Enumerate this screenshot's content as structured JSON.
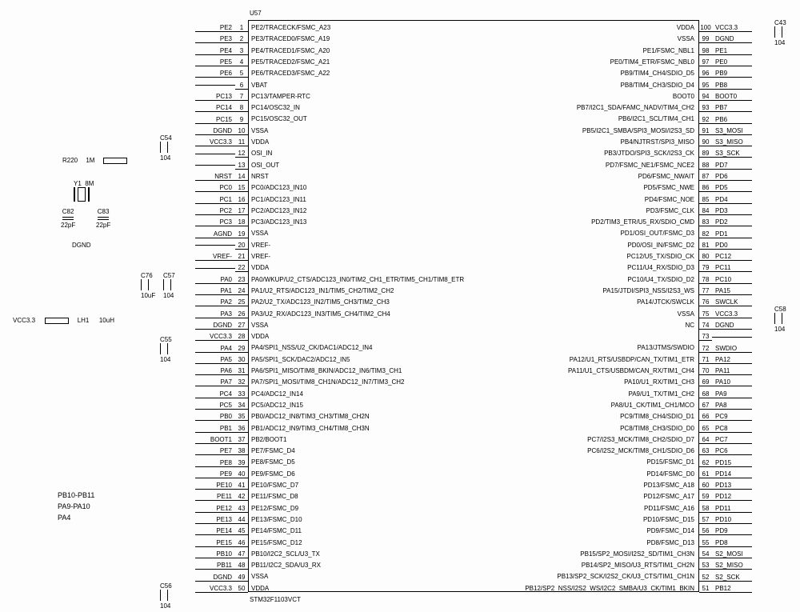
{
  "chip": {
    "ref": "U57",
    "part": "STM32F1103VCT"
  },
  "left_pins": [
    {
      "pin": "1",
      "net": "PE2",
      "func": "PE2/TRACECK/FSMC_A23"
    },
    {
      "pin": "2",
      "net": "PE3",
      "func": "PE3/TRACED0/FSMC_A19"
    },
    {
      "pin": "3",
      "net": "PE4",
      "func": "PE4/TRACED1/FSMC_A20"
    },
    {
      "pin": "4",
      "net": "PE5",
      "func": "PE5/TRACED2/FSMC_A21"
    },
    {
      "pin": "5",
      "net": "PE6",
      "func": "PE6/TRACED3/FSMC_A22"
    },
    {
      "pin": "6",
      "net": "",
      "func": "VBAT"
    },
    {
      "pin": "7",
      "net": "PC13",
      "func": "PC13/TAMPER-RTC"
    },
    {
      "pin": "8",
      "net": "PC14",
      "func": "PC14/OSC32_IN"
    },
    {
      "pin": "9",
      "net": "PC15",
      "func": "PC15/OSC32_OUT"
    },
    {
      "pin": "10",
      "net": "DGND",
      "func": "VSSA"
    },
    {
      "pin": "11",
      "net": "VCC3.3",
      "func": "VDDA"
    },
    {
      "pin": "12",
      "net": "",
      "func": "OSI_IN"
    },
    {
      "pin": "13",
      "net": "",
      "func": "OSI_OUT"
    },
    {
      "pin": "14",
      "net": "NRST",
      "func": "NRST"
    },
    {
      "pin": "15",
      "net": "PC0",
      "func": "PC0/ADC123_IN10"
    },
    {
      "pin": "16",
      "net": "PC1",
      "func": "PC1/ADC123_IN11"
    },
    {
      "pin": "17",
      "net": "PC2",
      "func": "PC2/ADC123_IN12"
    },
    {
      "pin": "18",
      "net": "PC3",
      "func": "PC3/ADC123_IN13"
    },
    {
      "pin": "19",
      "net": "AGND",
      "func": "VSSA"
    },
    {
      "pin": "20",
      "net": "",
      "func": "VREF-"
    },
    {
      "pin": "21",
      "net": "VREF-",
      "func": "VREF-"
    },
    {
      "pin": "22",
      "net": "",
      "func": "VDDA"
    },
    {
      "pin": "23",
      "net": "PA0",
      "func": "PA0/WKUP/U2_CTS/ADC123_IN0/TIM2_CH1_ETR/TIM5_CH1/TIM8_ETR"
    },
    {
      "pin": "24",
      "net": "PA1",
      "func": "PA1/U2_RTS/ADC123_IN1/TIM5_CH2/TIM2_CH2"
    },
    {
      "pin": "25",
      "net": "PA2",
      "func": "PA2/U2_TX/ADC123_IN2/TIM5_CH3/TIM2_CH3"
    },
    {
      "pin": "26",
      "net": "PA3",
      "func": "PA3/U2_RX/ADC123_IN3/TIM5_CH4/TIM2_CH4"
    },
    {
      "pin": "27",
      "net": "DGND",
      "func": "VSSA"
    },
    {
      "pin": "28",
      "net": "VCC3.3",
      "func": "VDDA"
    },
    {
      "pin": "29",
      "net": "PA4",
      "func": "PA4/SPI1_NSS/U2_CK/DAC1/ADC12_IN4"
    },
    {
      "pin": "30",
      "net": "PA5",
      "func": "PA5/SPI1_SCK/DAC2/ADC12_IN5"
    },
    {
      "pin": "31",
      "net": "PA6",
      "func": "PA6/SPI1_MISO/TIM8_BKIN/ADC12_IN6/TIM3_CH1"
    },
    {
      "pin": "32",
      "net": "PA7",
      "func": "PA7/SPI1_MOSI/TIM8_CH1N/ADC12_IN7/TIM3_CH2"
    },
    {
      "pin": "33",
      "net": "PC4",
      "func": "PC4/ADC12_IN14"
    },
    {
      "pin": "34",
      "net": "PC5",
      "func": "PC5/ADC12_IN15"
    },
    {
      "pin": "35",
      "net": "PB0",
      "func": "PB0/ADC12_IN8/TIM3_CH3/TIM8_CH2N"
    },
    {
      "pin": "36",
      "net": "PB1",
      "func": "PB1/ADC12_IN9/TIM3_CH4/TIM8_CH3N"
    },
    {
      "pin": "37",
      "net": "BOOT1",
      "func": "PB2/BOOT1"
    },
    {
      "pin": "38",
      "net": "PE7",
      "func": "PE7/FSMC_D4"
    },
    {
      "pin": "39",
      "net": "PE8",
      "func": "PE8/FSMC_D5"
    },
    {
      "pin": "40",
      "net": "PE9",
      "func": "PE9/FSMC_D6"
    },
    {
      "pin": "41",
      "net": "PE10",
      "func": "PE10/FSMC_D7"
    },
    {
      "pin": "42",
      "net": "PE11",
      "func": "PE11/FSMC_D8"
    },
    {
      "pin": "43",
      "net": "PE12",
      "func": "PE12/FSMC_D9"
    },
    {
      "pin": "44",
      "net": "PE13",
      "func": "PE13/FSMC_D10"
    },
    {
      "pin": "45",
      "net": "PE14",
      "func": "PE14/FSMC_D11"
    },
    {
      "pin": "46",
      "net": "PE15",
      "func": "PE15/FSMC_D12"
    },
    {
      "pin": "47",
      "net": "PB10",
      "func": "PB10/I2C2_SCL/U3_TX"
    },
    {
      "pin": "48",
      "net": "PB11",
      "func": "PB11/I2C2_SDA/U3_RX"
    },
    {
      "pin": "49",
      "net": "DGND",
      "func": "VSSA"
    },
    {
      "pin": "50",
      "net": "VCC3.3",
      "func": "VDDA"
    }
  ],
  "right_pins": [
    {
      "pin": "100",
      "net": "VCC3.3",
      "func": "VDDA"
    },
    {
      "pin": "99",
      "net": "DGND",
      "func": "VSSA"
    },
    {
      "pin": "98",
      "net": "PE1",
      "func": "PE1/FSMC_NBL1"
    },
    {
      "pin": "97",
      "net": "PE0",
      "func": "PE0/TIM4_ETR/FSMC_NBL0"
    },
    {
      "pin": "96",
      "net": "PB9",
      "func": "PB9/TIM4_CH4/SDIO_D5"
    },
    {
      "pin": "95",
      "net": "PB8",
      "func": "PB8/TIM4_CH3/SDIO_D4"
    },
    {
      "pin": "94",
      "net": "BOOT0",
      "func": "BOOT0"
    },
    {
      "pin": "93",
      "net": "PB7",
      "func": "PB7/I2C1_SDA/FAMC_NADV/TIM4_CH2"
    },
    {
      "pin": "92",
      "net": "PB6",
      "func": "PB6/I2C1_SCL/TIM4_CH1"
    },
    {
      "pin": "91",
      "net": "S3_MOSI",
      "func": "PB5/I2C1_SMBA/SPI3_MOSI/I2S3_SD"
    },
    {
      "pin": "90",
      "net": "S3_MISO",
      "func": "PB4/NJTRST/SPI3_MISO"
    },
    {
      "pin": "89",
      "net": "S3_SCK",
      "func": "PB3/JTDO/SPI3_SCK/I2S3_CK"
    },
    {
      "pin": "88",
      "net": "PD7",
      "func": "PD7/FSMC_NE1/FSMC_NCE2"
    },
    {
      "pin": "87",
      "net": "PD6",
      "func": "PD6/FSMC_NWAIT"
    },
    {
      "pin": "86",
      "net": "PD5",
      "func": "PD5/FSMC_NWE"
    },
    {
      "pin": "85",
      "net": "PD4",
      "func": "PD4/FSMC_NOE"
    },
    {
      "pin": "84",
      "net": "PD3",
      "func": "PD3/FSMC_CLK"
    },
    {
      "pin": "83",
      "net": "PD2",
      "func": "PD2/TIM3_ETR/U5_RX/SDIO_CMD"
    },
    {
      "pin": "82",
      "net": "PD1",
      "func": "PD1/OSI_OUT/FSMC_D3"
    },
    {
      "pin": "81",
      "net": "PD0",
      "func": "PD0/OSI_IN/FSMC_D2"
    },
    {
      "pin": "80",
      "net": "PC12",
      "func": "PC12/U5_TX/SDIO_CK"
    },
    {
      "pin": "79",
      "net": "PC11",
      "func": "PC11/U4_RX/SDIO_D3"
    },
    {
      "pin": "78",
      "net": "PC10",
      "func": "PC10/U4_TX/SDIO_D2"
    },
    {
      "pin": "77",
      "net": "PA15",
      "func": "PA15/JTDI/SPI3_NSS/I2S3_WS"
    },
    {
      "pin": "76",
      "net": "SWCLK",
      "func": "PA14/JTCK/SWCLK"
    },
    {
      "pin": "75",
      "net": "VCC3.3",
      "func": "VSSA"
    },
    {
      "pin": "74",
      "net": "DGND",
      "func": "NC"
    },
    {
      "pin": "73",
      "net": "",
      "func": ""
    },
    {
      "pin": "72",
      "net": "SWDIO",
      "func": "PA13/JTMS/SWDIO"
    },
    {
      "pin": "71",
      "net": "PA12",
      "func": "PA12/U1_RTS/USBDP/CAN_TX/TIM1_ETR"
    },
    {
      "pin": "70",
      "net": "PA11",
      "func": "PA11/U1_CTS/USBDM/CAN_RX/TIM1_CH4"
    },
    {
      "pin": "69",
      "net": "PA10",
      "func": "PA10/U1_RX/TIM1_CH3"
    },
    {
      "pin": "68",
      "net": "PA9",
      "func": "PA9/U1_TX/TIM1_CH2"
    },
    {
      "pin": "67",
      "net": "PA8",
      "func": "PA8/U1_CK/TIM1_CH1/MCO"
    },
    {
      "pin": "66",
      "net": "PC9",
      "func": "PC9/TIM8_CH4/SDIO_D1"
    },
    {
      "pin": "65",
      "net": "PC8",
      "func": "PC8/TIM8_CH3/SDIO_D0"
    },
    {
      "pin": "64",
      "net": "PC7",
      "func": "PC7/I2S3_MCK/TIM8_CH2/SDIO_D7"
    },
    {
      "pin": "63",
      "net": "PC6",
      "func": "PC6/I2S2_MCK/TIM8_CH1/SDIO_D6"
    },
    {
      "pin": "62",
      "net": "PD15",
      "func": "PD15/FSMC_D1"
    },
    {
      "pin": "61",
      "net": "PD14",
      "func": "PD14/FSMC_D0"
    },
    {
      "pin": "60",
      "net": "PD13",
      "func": "PD13/FSMC_A18"
    },
    {
      "pin": "59",
      "net": "PD12",
      "func": "PD12/FSMC_A17"
    },
    {
      "pin": "58",
      "net": "PD11",
      "func": "PD11/FSMC_A16"
    },
    {
      "pin": "57",
      "net": "PD10",
      "func": "PD10/FSMC_D15"
    },
    {
      "pin": "56",
      "net": "PD9",
      "func": "PD9/FSMC_D14"
    },
    {
      "pin": "55",
      "net": "PD8",
      "func": "PD8/FSMC_D13"
    },
    {
      "pin": "54",
      "net": "S2_MOSI",
      "func": "PB15/SP2_MOSI/I2S2_SD/TIM1_CH3N"
    },
    {
      "pin": "53",
      "net": "S2_MISO",
      "func": "PB14/SP2_MISO/U3_RTS/TIM1_CH2N"
    },
    {
      "pin": "52",
      "net": "S2_SCK",
      "func": "PB13/SP2_SCK/I2S2_CK/U3_CTS/TIM1_CH1N"
    },
    {
      "pin": "51",
      "net": "PB12",
      "func": "PB12/SP2_NSS/I2S2_WS/I2C2_SMBA/U3_CK/TIM1_BKIN"
    }
  ],
  "components": {
    "c54": {
      "ref": "C54",
      "val": "104"
    },
    "c55": {
      "ref": "C55",
      "val": "104"
    },
    "c56": {
      "ref": "C56",
      "val": "104"
    },
    "c76": {
      "ref": "C76",
      "val": "10uF"
    },
    "c57": {
      "ref": "C57",
      "val": "104"
    },
    "c82": {
      "ref": "C82",
      "val": "22pF"
    },
    "c83": {
      "ref": "C83",
      "val": "22pF"
    },
    "c43": {
      "ref": "C43",
      "val": "104"
    },
    "c58": {
      "ref": "C58",
      "val": "104"
    },
    "r220": {
      "ref": "R220",
      "val": "1M"
    },
    "y1": {
      "ref": "Y1",
      "val": "8M"
    },
    "lh1": {
      "ref": "LH1",
      "val": "10uH"
    },
    "vcc": "VCC3.3",
    "dgnd": "DGND"
  },
  "notes": {
    "l1": "PB10-PB11",
    "l2": "PA9-PA10",
    "l3": "PA4"
  }
}
